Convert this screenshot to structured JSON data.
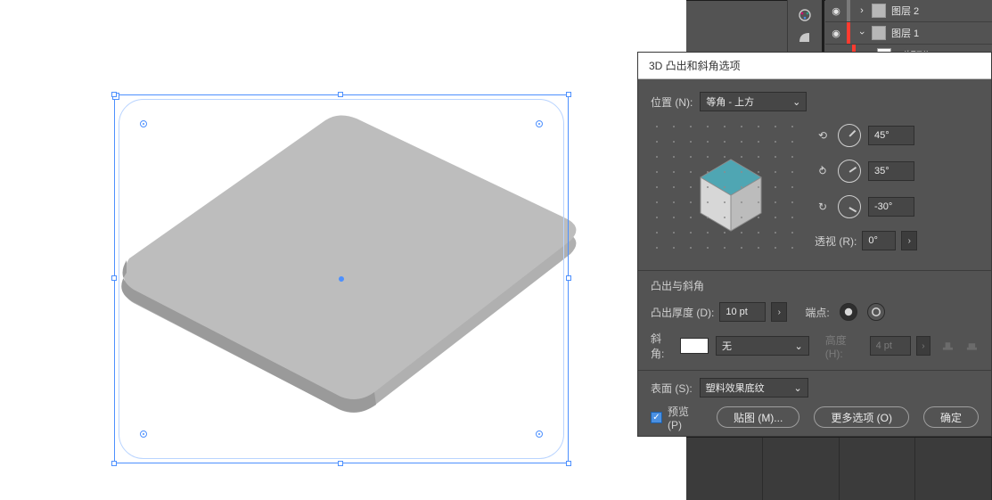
{
  "layers": {
    "row1_label": "图层 2",
    "row2_label": "图层 1",
    "row3_label": "〈矩形〉"
  },
  "dialog": {
    "title": "3D 凸出和斜角选项",
    "position_label": "位置 (N):",
    "position_value": "等角 - 上方",
    "angle1": "45°",
    "angle2": "35°",
    "angle3": "-30°",
    "perspective_label": "透视 (R):",
    "perspective_value": "0°",
    "section_extrude": "凸出与斜角",
    "extrude_depth_label": "凸出厚度 (D):",
    "extrude_depth_value": "10 pt",
    "cap_label": "端点:",
    "bevel_label": "斜角:",
    "bevel_value": "无",
    "height_label": "高度 (H):",
    "height_value": "4 pt",
    "surface_label": "表面 (S):",
    "surface_value": "塑料效果底纹",
    "preview_label": "预览 (P)",
    "map_btn": "贴图 (M)...",
    "more_btn": "更多选项 (O)",
    "ok_btn": "确定"
  }
}
